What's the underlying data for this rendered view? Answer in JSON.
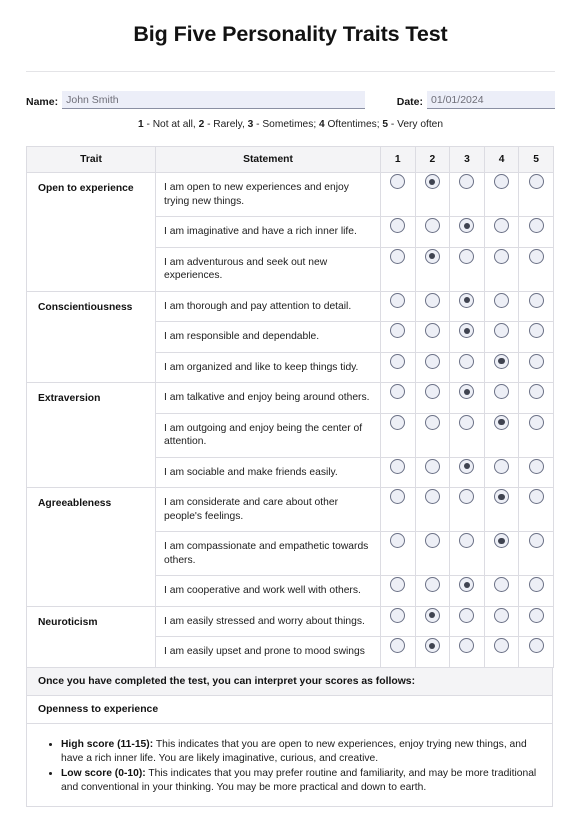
{
  "document": {
    "title": "Big Five Personality Traits Test"
  },
  "identity": {
    "name_label": "Name:",
    "name_value": "John Smith",
    "date_label": "Date:",
    "date_value": "01/01/2024"
  },
  "scale": {
    "legend_parts": [
      {
        "num": "1",
        "text": " - Not at all, "
      },
      {
        "num": "2",
        "text": " - Rarely, "
      },
      {
        "num": "3",
        "text": " - Sometimes; "
      },
      {
        "num": "4",
        "text": " Oftentimes; "
      },
      {
        "num": "5",
        "text": " - Very often"
      }
    ]
  },
  "table": {
    "headers": {
      "trait": "Trait",
      "statement": "Statement",
      "scale": [
        "1",
        "2",
        "3",
        "4",
        "5"
      ]
    },
    "groups": [
      {
        "trait": "Open to experience",
        "rows": [
          {
            "statement": "I am open to new experiences and enjoy trying new things.",
            "selected": 2
          },
          {
            "statement": "I am imaginative and have a rich inner life.",
            "selected": 3
          },
          {
            "statement": "I am adventurous and seek out new experiences.",
            "selected": 2
          }
        ]
      },
      {
        "trait": "Conscientiousness",
        "rows": [
          {
            "statement": "I am thorough and pay attention to detail.",
            "selected": 3
          },
          {
            "statement": "I am responsible and dependable.",
            "selected": 3
          },
          {
            "statement": "I am organized and like to keep things tidy.",
            "selected": 4
          }
        ]
      },
      {
        "trait": "Extraversion",
        "rows": [
          {
            "statement": "I am talkative and enjoy being around others.",
            "selected": 3
          },
          {
            "statement": "I am outgoing and enjoy being the center of attention.",
            "selected": 4
          },
          {
            "statement": "I am sociable and make friends easily.",
            "selected": 3
          }
        ]
      },
      {
        "trait": "Agreeableness",
        "rows": [
          {
            "statement": "I am considerate and care about other people's feelings.",
            "selected": 4
          },
          {
            "statement": "I am compassionate and empathetic towards others.",
            "selected": 4
          },
          {
            "statement": "I am cooperative and work well with others.",
            "selected": 3
          }
        ]
      },
      {
        "trait": "Neuroticism",
        "rows": [
          {
            "statement": "I am easily stressed and worry about things.",
            "selected": 2
          },
          {
            "statement": "I am easily upset and prone to mood swings",
            "selected": 2
          }
        ]
      }
    ]
  },
  "interpretation": {
    "band_text": "Once you have completed the test, you can interpret your scores as follows:",
    "subheading": "Openness to experience",
    "bullets": [
      {
        "label": "High score (11-15):",
        "text": " This indicates that you are open to new experiences, enjoy trying new things, and have a rich inner life. You are likely imaginative, curious, and creative."
      },
      {
        "label": "Low score (0-10):",
        "text": " This indicates that you may prefer routine and familiarity, and may be more traditional and conventional in your thinking. You may be more practical and down to earth."
      }
    ]
  },
  "colors": {
    "field_background": "#eceef8",
    "header_background": "#f4f4f6",
    "border": "#dcdce2",
    "radio_fill": "#edeff6",
    "radio_border": "#6b7186",
    "radio_dot": "#3f4350"
  }
}
